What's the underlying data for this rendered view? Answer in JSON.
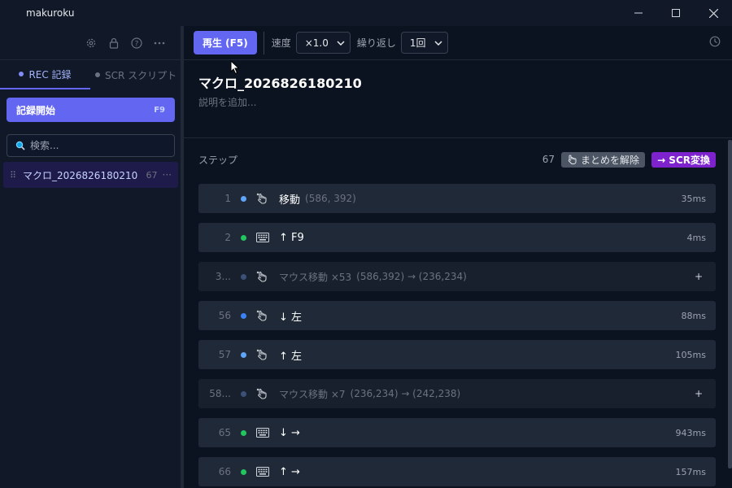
{
  "window": {
    "title": "makuroku"
  },
  "colors": {
    "accent": "#6366f1",
    "mouse_dot": "#60a5fa",
    "key_dot": "#22c55e",
    "group_dot": "#3b5178",
    "scr": "#7e22ce"
  },
  "sidebar": {
    "tools": [
      "gear-icon",
      "lock-icon",
      "help-icon",
      "more-icon"
    ],
    "tabs": [
      {
        "label": "REC 記録"
      },
      {
        "label": "SCR スクリプト"
      }
    ],
    "record_button": {
      "label": "記録開始",
      "shortcut": "F9"
    },
    "search": {
      "placeholder": "検索..."
    },
    "macros": [
      {
        "name": "マクロ_2026826180210",
        "count": "67",
        "more": "···"
      }
    ]
  },
  "toolbar": {
    "play_label": "再生 (F5)",
    "speed_label": "速度",
    "speed_value": "×1.0",
    "repeat_label": "繰り返し",
    "repeat_value": "1回"
  },
  "macro": {
    "title": "マクロ_2026826180210",
    "description_placeholder": "説明を追加..."
  },
  "steps_header": {
    "label": "ステップ",
    "count": "67",
    "ungroup_label": "まとめを解除",
    "scr_label": "→ SCR変換"
  },
  "steps": [
    {
      "num": "1",
      "kind": "mouse",
      "action": "移動",
      "detail": "(586, 392)",
      "duration": "35ms"
    },
    {
      "num": "2",
      "kind": "key",
      "action": "↑ F9",
      "detail": "",
      "duration": "4ms"
    },
    {
      "num": "3...",
      "kind": "group",
      "action": "マウス移動 ×53",
      "detail": "(586,392) → (236,234)",
      "expand": "+"
    },
    {
      "num": "56",
      "kind": "mouse-down",
      "action": "↓ 左",
      "detail": "",
      "duration": "88ms"
    },
    {
      "num": "57",
      "kind": "mouse",
      "action": "↑ 左",
      "detail": "",
      "duration": "105ms"
    },
    {
      "num": "58...",
      "kind": "group",
      "action": "マウス移動 ×7",
      "detail": "(236,234) → (242,238)",
      "expand": "+"
    },
    {
      "num": "65",
      "kind": "key",
      "action": "↓ →",
      "detail": "",
      "duration": "943ms"
    },
    {
      "num": "66",
      "kind": "key",
      "action": "↑ →",
      "detail": "",
      "duration": "157ms"
    }
  ]
}
